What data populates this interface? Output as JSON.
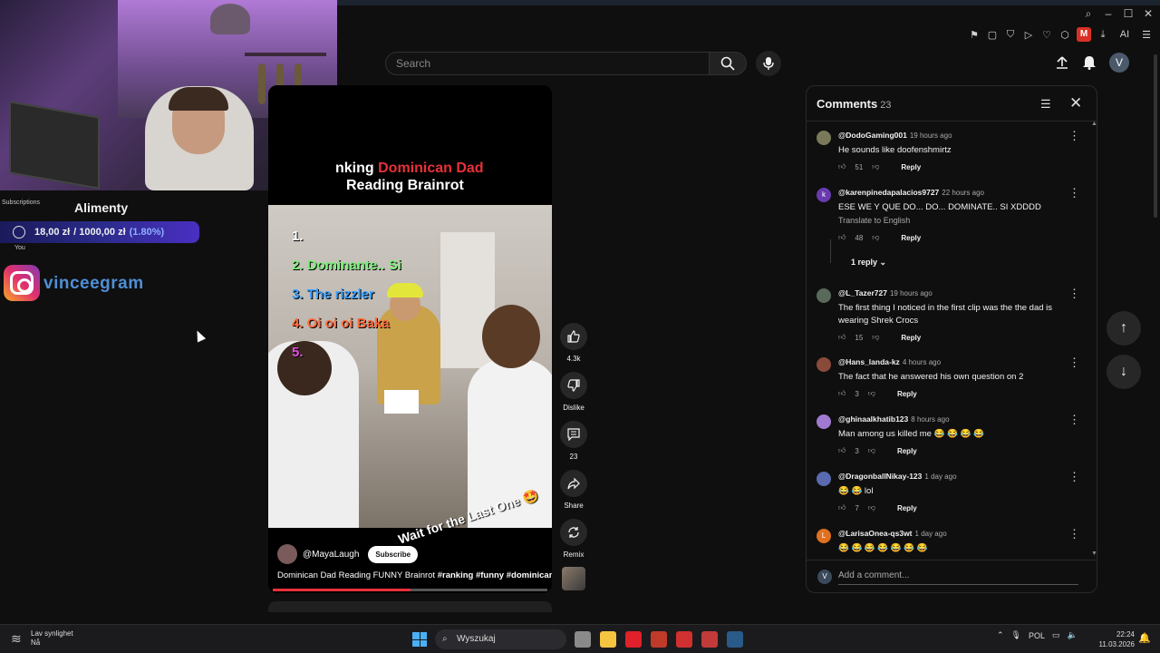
{
  "window": {
    "controls": [
      "search",
      "minimize",
      "maximize",
      "close"
    ]
  },
  "extensions": {
    "m_badge": "M",
    "ai_label": "AI"
  },
  "stream_overlay": {
    "subscriptions_label": "Subscriptions",
    "goal_title": "Alimenty",
    "goal_amount": "18,00 zł",
    "goal_target": "/ 1000,00 zł",
    "goal_percent": "(1.80%)",
    "goal_progress": 0.018,
    "you_label": "You",
    "instagram_handle": "vinceegram"
  },
  "search": {
    "placeholder": "Search"
  },
  "header_icons": {
    "avatar_letter": "V"
  },
  "video": {
    "title_prefix": "nking ",
    "title_highlight": "Dominican Dad",
    "title_line2": "Reading Brainrot",
    "list": [
      {
        "text": "1.",
        "color": "#ffffff"
      },
      {
        "text": "2.  Dominante.. Si",
        "color": "#7cf07a"
      },
      {
        "text": "3.  The rizzler",
        "color": "#3aa0ff"
      },
      {
        "text": "4.  Oi oi oi Baka",
        "color": "#ff6a3a"
      },
      {
        "text": "5.",
        "color": "#e050e0"
      }
    ],
    "overlay_caption": "Wait for the Last One 🤩",
    "channel": "@MayaLaugh",
    "subscribe_label": "Subscribe",
    "description": "Dominican Dad Reading FUNNY Brainrot",
    "hashtags": "#ranking #funny #dominican",
    "progress": 0.5
  },
  "actions": {
    "like_count": "4.3k",
    "dislike_label": "Dislike",
    "comment_count": "23",
    "share_label": "Share",
    "remix_label": "Remix"
  },
  "comments": {
    "title": "Comments",
    "count": "23",
    "add_placeholder": "Add a comment...",
    "add_avatar": "V",
    "translate_label": "Translate to English",
    "replies_label": "1 reply",
    "reply_label": "Reply",
    "items": [
      {
        "user": "@DodoGaming001",
        "ago": "19 hours ago",
        "text": "He sounds like doofenshmirtz",
        "likes": "51",
        "avatar_color": "#7a7a5a",
        "avatar_letter": ""
      },
      {
        "user": "@karenpinedapalacios9727",
        "ago": "22 hours ago",
        "text": "ESE WE Y QUE DO... DO... DOMINATE.. SI XDDDD",
        "likes": "48",
        "avatar_color": "#6a3ab0",
        "avatar_letter": "k"
      },
      {
        "user": "@L_Tazer727",
        "ago": "19 hours ago",
        "text": "The first thing I noticed in the first clip was the the dad is wearing Shrek Crocs",
        "likes": "15",
        "avatar_color": "#5a6a5a",
        "avatar_letter": ""
      },
      {
        "user": "@Hans_landa-kz",
        "ago": "4 hours ago",
        "text": "The fact that he answered his own question on 2",
        "likes": "3",
        "avatar_color": "#8a4a3a",
        "avatar_letter": ""
      },
      {
        "user": "@ghinaalkhatib123",
        "ago": "8 hours ago",
        "text": "Man among us killed me 😂 😂 😂 😂",
        "likes": "3",
        "avatar_color": "#a07ad0",
        "avatar_letter": ""
      },
      {
        "user": "@DragonballNikay-123",
        "ago": "1 day ago",
        "text": "😂 😂  lol",
        "likes": "7",
        "avatar_color": "#5a6ab0",
        "avatar_letter": ""
      },
      {
        "user": "@LarisaOnea-qs3wt",
        "ago": "1 day ago",
        "text": "😂 😂 😂 😂 😂 😂 😂",
        "likes": "",
        "avatar_color": "#e07020",
        "avatar_letter": "L"
      }
    ]
  },
  "taskbar": {
    "weather_line1": "Lav synlighet",
    "weather_line2": "Nå",
    "search_placeholder": "Wyszukaj",
    "language": "POL",
    "time": "22:24",
    "date": "11.03.2026",
    "apps": [
      {
        "name": "task-view",
        "color": "#8a8a8a"
      },
      {
        "name": "file-explorer",
        "color": "#f5c542"
      },
      {
        "name": "opera",
        "color": "#e0202a"
      },
      {
        "name": "app-red",
        "color": "#c03a2a"
      },
      {
        "name": "shield-app",
        "color": "#d03030"
      },
      {
        "name": "yellow-app",
        "color": "#c23a3a"
      },
      {
        "name": "steam",
        "color": "#2a5a8a"
      }
    ]
  }
}
